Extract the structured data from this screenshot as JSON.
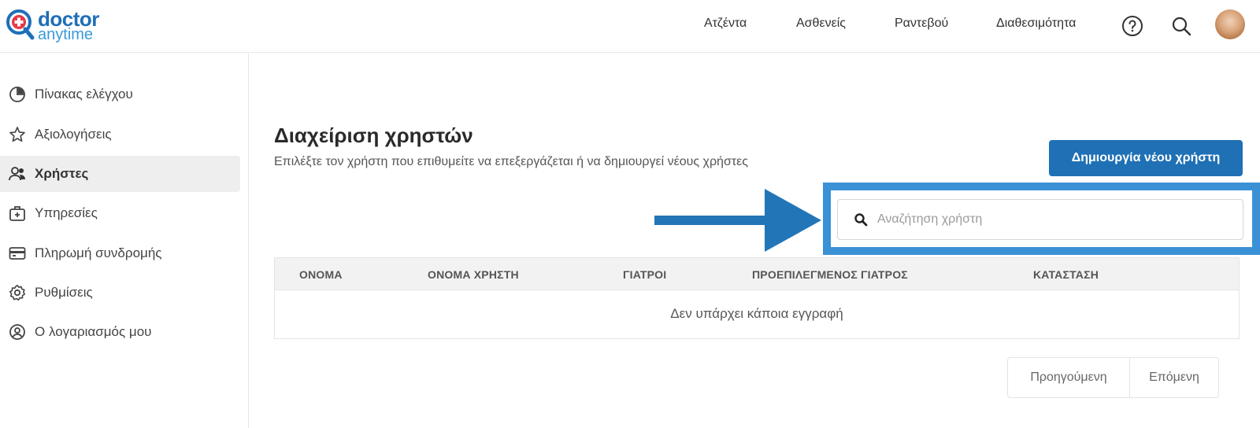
{
  "brand": {
    "line1": "doctor",
    "line2": "anytime"
  },
  "nav": {
    "items": [
      "Ατζέντα",
      "Ασθενείς",
      "Ραντεβού",
      "Διαθεσιμότητα"
    ]
  },
  "sidebar": {
    "items": [
      {
        "label": "Πίνακας ελέγχου",
        "icon": "pie-chart-icon"
      },
      {
        "label": "Αξιολογήσεις",
        "icon": "star-icon"
      },
      {
        "label": "Χρήστες",
        "icon": "users-icon",
        "active": true
      },
      {
        "label": "Υπηρεσίες",
        "icon": "medical-bag-icon"
      },
      {
        "label": "Πληρωμή συνδρομής",
        "icon": "credit-card-icon"
      },
      {
        "label": "Ρυθμίσεις",
        "icon": "gear-icon"
      },
      {
        "label": "Ο λογαριασμός μου",
        "icon": "user-circle-icon"
      }
    ]
  },
  "main": {
    "title": "Διαχείριση χρηστών",
    "subtitle": "Επιλέξτε τον χρήστη που επιθυμείτε να επεξεργάζεται ή να δημιουργεί νέους χρήστες",
    "create_button": "Δημιουργία νέου χρήστη",
    "search": {
      "placeholder": "Αναζήτηση χρήστη",
      "value": ""
    },
    "table": {
      "columns": [
        "ΟΝΟΜΑ",
        "ΟΝΟΜΑ ΧΡΗΣΤΗ",
        "ΓΙΑΤΡΟΙ",
        "ΠΡΟΕΠΙΛΕΓΜΕΝΟΣ ΓΙΑΤΡΟΣ",
        "ΚΑΤΑΣΤΑΣΗ"
      ],
      "rows": [],
      "empty_message": "Δεν υπάρχει κάποια εγγραφή"
    },
    "pagination": {
      "prev": "Προηγούμενη",
      "next": "Επόμενη"
    }
  },
  "colors": {
    "brand_blue": "#1f70b5",
    "highlight_blue": "#3a91d6",
    "arrow_blue": "#2276b8"
  }
}
